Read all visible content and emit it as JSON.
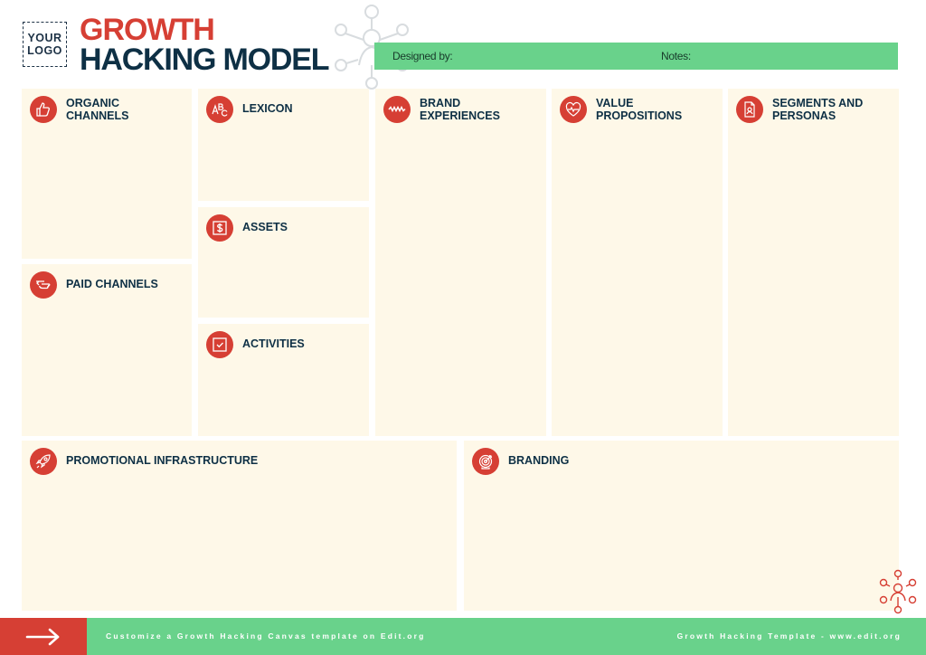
{
  "header": {
    "logo_line1": "YOUR",
    "logo_line2": "LOGO",
    "title_line1": "GROWTH",
    "title_line2": "HACKING MODEL",
    "designed_by_label": "Designed by:",
    "notes_label": "Notes:"
  },
  "sections": [
    {
      "id": "organic-channels",
      "label": "ORGANIC\nCHANNELS",
      "icon": "thumbs-up-icon"
    },
    {
      "id": "lexicon",
      "label": "LEXICON",
      "icon": "abc-icon"
    },
    {
      "id": "assets",
      "label": "ASSETS",
      "icon": "dollar-icon"
    },
    {
      "id": "activities",
      "label": "ACTIVITIES",
      "icon": "checkbox-icon"
    },
    {
      "id": "paid-channels",
      "label": "PAID CHANNELS",
      "icon": "pointing-hand-icon"
    },
    {
      "id": "brand-experiences",
      "label": "BRAND\nEXPERIENCES",
      "icon": "wave-icon"
    },
    {
      "id": "value-propositions",
      "label": "VALUE\nPROPOSITIONS",
      "icon": "heart-pulse-icon"
    },
    {
      "id": "segments-personas",
      "label": "SEGMENTS AND\nPERSONAS",
      "icon": "persona-document-icon"
    },
    {
      "id": "promotional-infrastructure",
      "label": "PROMOTIONAL INFRASTRUCTURE",
      "icon": "rocket-icon"
    },
    {
      "id": "branding",
      "label": "BRANDING",
      "icon": "target-icon"
    }
  ],
  "footer": {
    "arrow_icon": "arrow-right-icon",
    "left_text": "Customize a Growth Hacking Canvas template on Edit.org",
    "right_text": "Growth Hacking Template - www.edit.org"
  },
  "colors": {
    "accent_red": "#d63f34",
    "accent_green": "#69d28b",
    "navy": "#0e3045",
    "box_fill": "#fef8e8"
  }
}
